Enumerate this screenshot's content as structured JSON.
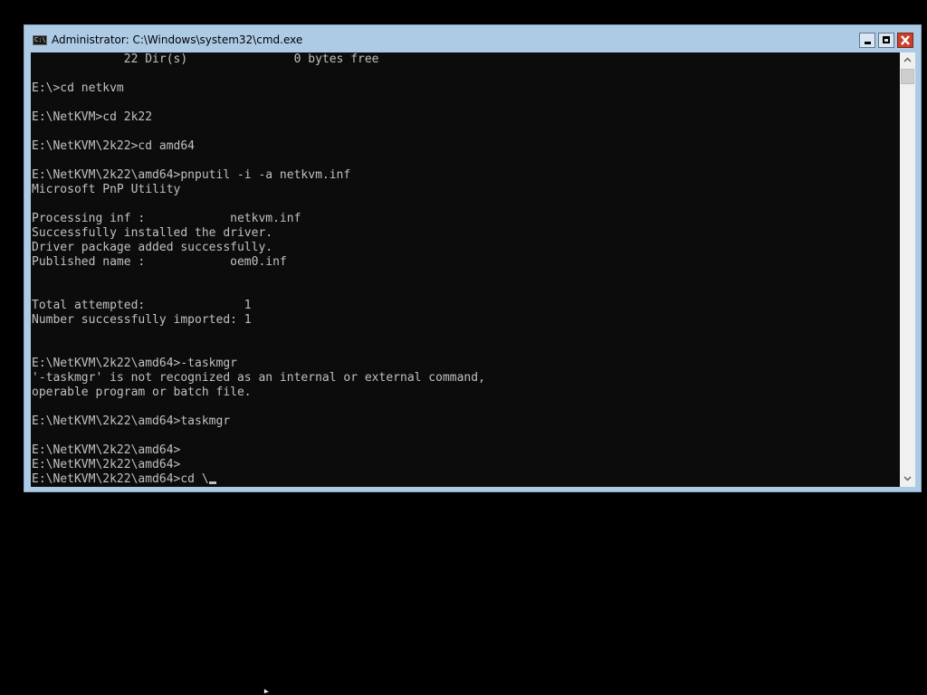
{
  "window": {
    "title": "Administrator: C:\\Windows\\system32\\cmd.exe",
    "icon_label": "C:\\"
  },
  "console": {
    "lines": [
      "             22 Dir(s)               0 bytes free",
      "",
      "E:\\>cd netkvm",
      "",
      "E:\\NetKVM>cd 2k22",
      "",
      "E:\\NetKVM\\2k22>cd amd64",
      "",
      "E:\\NetKVM\\2k22\\amd64>pnputil -i -a netkvm.inf",
      "Microsoft PnP Utility",
      "",
      "Processing inf :            netkvm.inf",
      "Successfully installed the driver.",
      "Driver package added successfully.",
      "Published name :            oem0.inf",
      "",
      "",
      "Total attempted:              1",
      "Number successfully imported: 1",
      "",
      "",
      "E:\\NetKVM\\2k22\\amd64>-taskmgr",
      "'-taskmgr' is not recognized as an internal or external command,",
      "operable program or batch file.",
      "",
      "E:\\NetKVM\\2k22\\amd64>taskmgr",
      "",
      "E:\\NetKVM\\2k22\\amd64>",
      "E:\\NetKVM\\2k22\\amd64>",
      "E:\\NetKVM\\2k22\\amd64>cd \\"
    ]
  },
  "icons": {
    "minimize": "minimize-icon",
    "maximize": "maximize-icon",
    "close": "close-icon",
    "scroll_up": "scroll-up-icon",
    "scroll_down": "scroll-down-icon",
    "pointer": "mouse-pointer-icon"
  },
  "colors": {
    "titlebar": "#aecbe6",
    "console_bg": "#0c0c0c",
    "console_text": "#c0c0c0",
    "close_button": "#c8412f"
  }
}
